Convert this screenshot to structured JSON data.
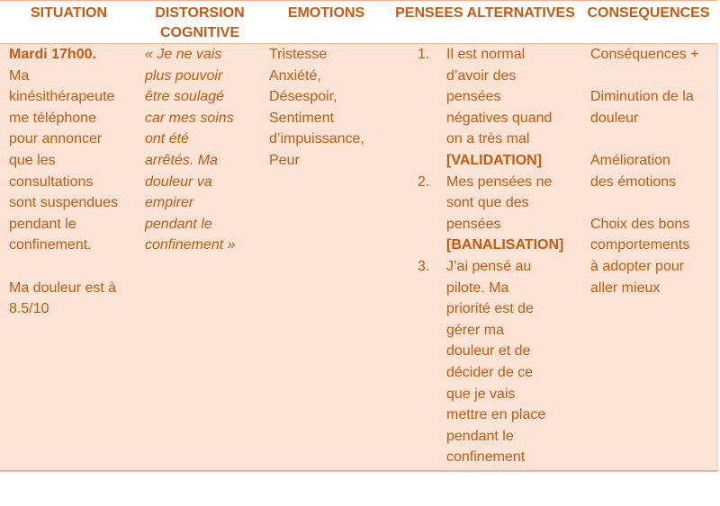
{
  "table": {
    "headers": {
      "situation": "SITUATION",
      "distorsion_line1": "DISTORSION",
      "distorsion_line2": "COGNITIVE",
      "emotions": "EMOTIONS",
      "pensees": "PENSEES ALTERNATIVES",
      "consequences": "CONSEQUENCES"
    },
    "situation": {
      "time": "Mardi 17h00.",
      "lines": [
        "Ma",
        "kinésithérapeute",
        "me téléphone",
        "pour annoncer",
        "que les",
        "consultations",
        "sont suspendues",
        "pendant le",
        "confinement."
      ],
      "pain_lines": [
        "Ma douleur est à",
        "8.5/10"
      ]
    },
    "distorsion": {
      "lines": [
        "« Je ne vais",
        "plus pouvoir",
        "être soulagé",
        "car mes soins",
        "ont été",
        "arrêtés.  Ma",
        "douleur va",
        "empirer",
        "pendant le",
        "confinement »"
      ]
    },
    "emotions": {
      "lines": [
        "Tristesse",
        "Anxiété,",
        "Désespoir,",
        "Sentiment",
        "d’impuissance,",
        "Peur"
      ]
    },
    "pensees": {
      "items": [
        {
          "num": "1.",
          "lines": [
            "Il est normal",
            "d’avoir des",
            "pensées",
            "négatives quand",
            "on a très mal"
          ],
          "tag": "[VALIDATION]"
        },
        {
          "num": "2.",
          "lines": [
            "Mes pensées ne",
            "sont que des",
            "pensées"
          ],
          "tag": "[BANALISATION]"
        },
        {
          "num": "3.",
          "lines": [
            "J’ai pensé au",
            "pilote.  Ma",
            "priorité est de",
            "gérer ma",
            "douleur et de",
            "décider de ce",
            "que je vais",
            "mettre en place",
            "pendant le",
            "confinement"
          ],
          "tag": ""
        }
      ]
    },
    "consequences": {
      "groups": [
        [
          "Conséquences +"
        ],
        [
          "Diminution de la",
          "douleur"
        ],
        [
          "Amélioration",
          "des émotions"
        ],
        [
          "Choix des bons",
          "comportements",
          "à adopter pour",
          "aller mieux"
        ]
      ]
    }
  },
  "colors": {
    "text": "#c55a11",
    "cell_background": "#fbe4d5",
    "header_border": "#f4b083"
  }
}
